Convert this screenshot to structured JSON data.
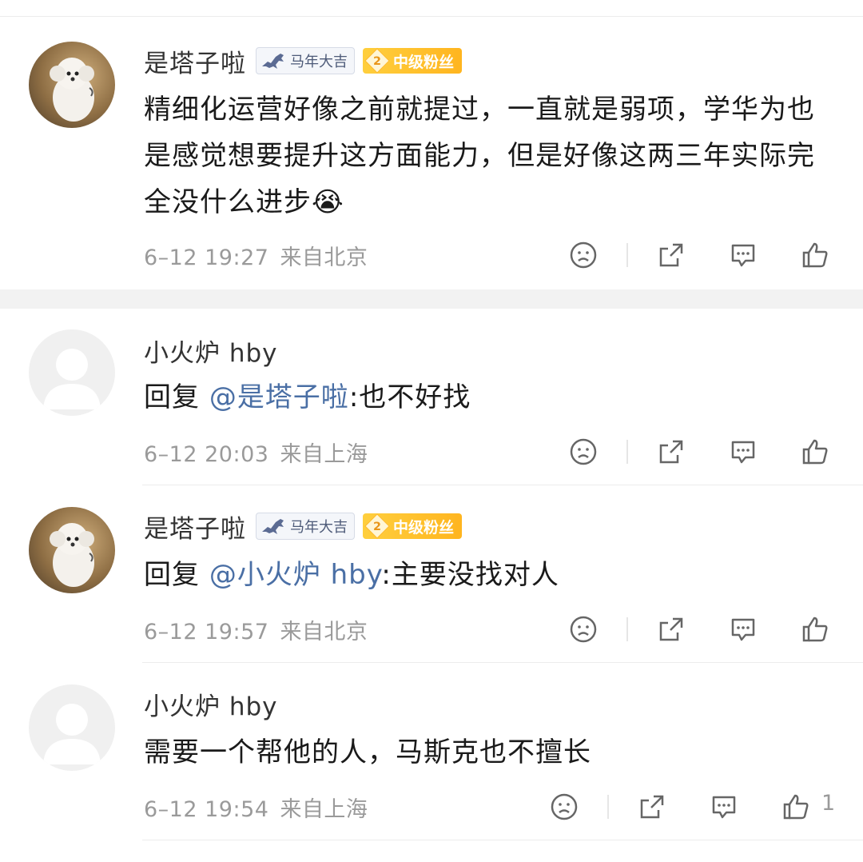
{
  "comments": [
    {
      "user": "是塔子啦",
      "badge_year": "马年大吉",
      "badge_fan_level": "2",
      "badge_fan": "中级粉丝",
      "text": "精细化运营好像之前就提过，一直就是弱项，学华为也是感觉想要提升这方面能力，但是好像这两三年实际完全没什么进步",
      "emoji": "😭",
      "time": "6–12 19:27",
      "location": "来自北京"
    },
    {
      "user": "小火炉 hby",
      "reply_prefix": "回复",
      "mention": "@是塔子啦",
      "text": ":也不好找",
      "time": "6–12 20:03",
      "location": "来自上海"
    },
    {
      "user": "是塔子啦",
      "badge_year": "马年大吉",
      "badge_fan_level": "2",
      "badge_fan": "中级粉丝",
      "reply_prefix": "回复",
      "mention": "@小火炉 hby",
      "text": ":主要没找对人",
      "time": "6–12 19:57",
      "location": "来自北京"
    },
    {
      "user": "小火炉 hby",
      "text": "需要一个帮他的人，马斯克也不擅长",
      "time": "6–12 19:54",
      "location": "来自上海",
      "like_count": "1"
    }
  ],
  "icons": {
    "dislike": "frown-face-icon",
    "repost": "share-icon",
    "comment": "comment-bubble-icon",
    "like": "thumbs-up-icon"
  },
  "colors": {
    "mention": "#4a6fa5",
    "meta": "#9a9a9a",
    "fan_badge": "#ffbe2c"
  }
}
